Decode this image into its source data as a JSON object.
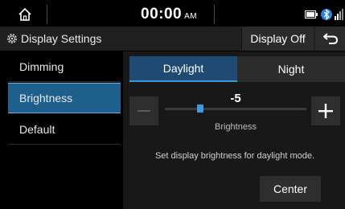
{
  "status_bar": {
    "time": "00:00",
    "ampm": "AM",
    "icons": [
      "home-icon",
      "battery-icon",
      "bluetooth-icon",
      "signal-icon"
    ]
  },
  "header": {
    "title": "Display Settings",
    "display_off_label": "Display Off",
    "back_icon": "back-arrow-icon",
    "settings_icon": "gear-icon"
  },
  "sidebar": {
    "items": [
      {
        "label": "Dimming",
        "active": false
      },
      {
        "label": "Brightness",
        "active": true
      },
      {
        "label": "Default",
        "active": false
      }
    ]
  },
  "content": {
    "tabs": [
      {
        "label": "Daylight",
        "active": true
      },
      {
        "label": "Night",
        "active": false
      }
    ],
    "slider": {
      "value": "-5",
      "min": -10,
      "max": 10,
      "label": "Brightness",
      "minus_icon": "minus-icon",
      "plus_icon": "plus-icon"
    },
    "description": "Set display brightness for daylight mode.",
    "center_label": "Center"
  },
  "colors": {
    "accent": "#3e97d9",
    "active_menu": "#1e5f8e",
    "active_tab": "#1e4a73"
  }
}
